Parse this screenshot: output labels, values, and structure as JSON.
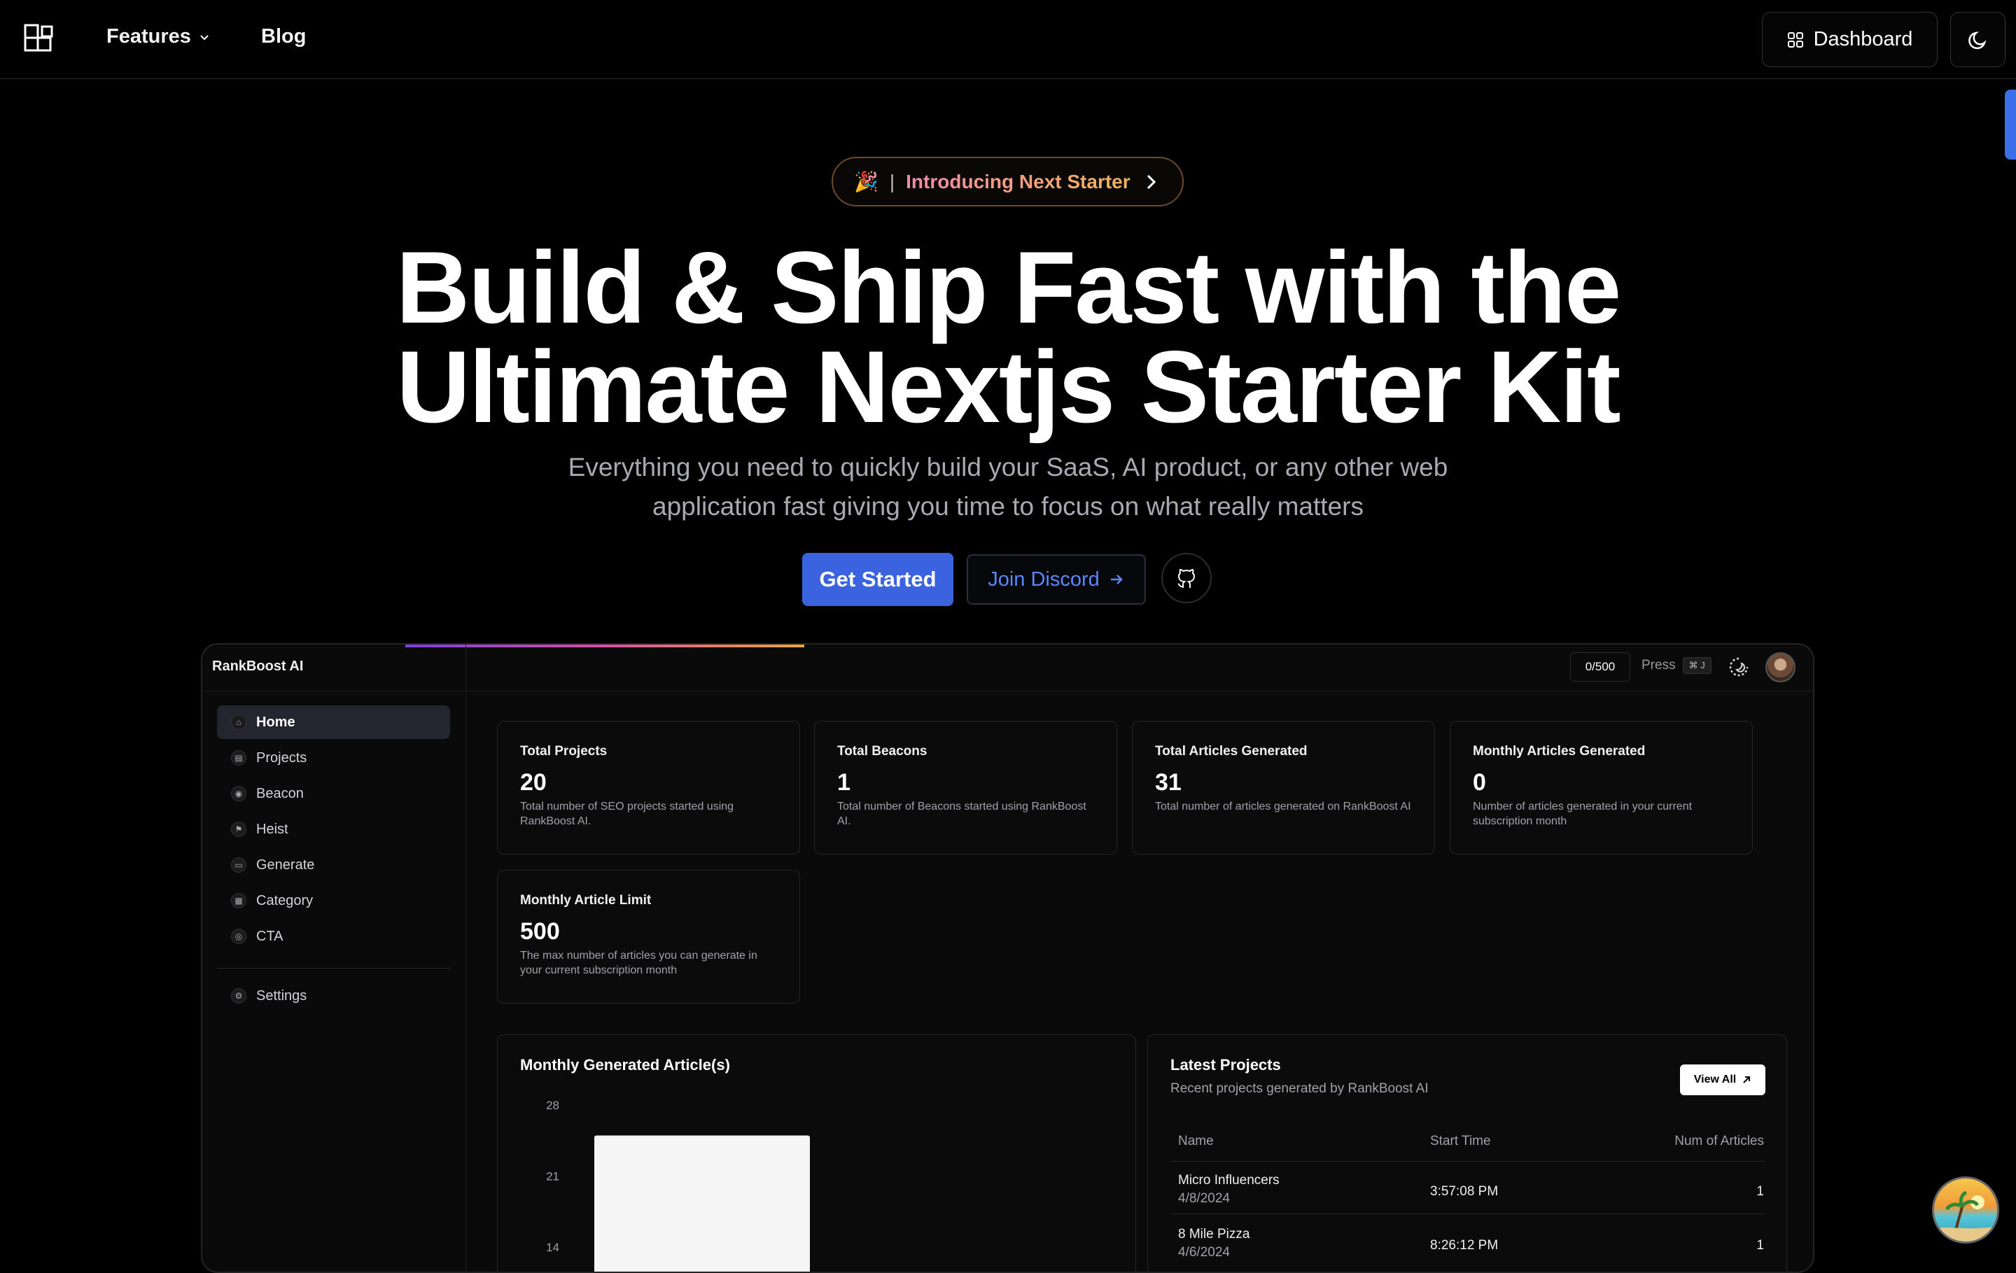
{
  "nav": {
    "features": "Features",
    "blog": "Blog",
    "dashboard": "Dashboard"
  },
  "hero": {
    "badge_emoji": "🎉",
    "badge_sep": "|",
    "badge_text": "Introducing Next Starter",
    "title_line1": "Build & Ship Fast with the",
    "title_line2": "Ultimate Nextjs Starter Kit",
    "subtitle_line1": "Everything you need to quickly build your SaaS, AI product, or any other web",
    "subtitle_line2": "application fast giving you time to focus on what really matters",
    "get_started": "Get Started",
    "join_discord": "Join Discord"
  },
  "app": {
    "brand": "RankBoost AI",
    "counter": "0/500",
    "press": "Press",
    "kbd": "⌘ J",
    "sidebar": [
      {
        "label": "Home",
        "icon": "home-icon",
        "glyph": "⌂"
      },
      {
        "label": "Projects",
        "icon": "file-icon",
        "glyph": "▤"
      },
      {
        "label": "Beacon",
        "icon": "beacon-icon",
        "glyph": "◉"
      },
      {
        "label": "Heist",
        "icon": "heist-icon",
        "glyph": "⚑"
      },
      {
        "label": "Generate",
        "icon": "folder-icon",
        "glyph": "▭"
      },
      {
        "label": "Category",
        "icon": "category-icon",
        "glyph": "▦"
      },
      {
        "label": "CTA",
        "icon": "target-icon",
        "glyph": "◎"
      }
    ],
    "settings": {
      "label": "Settings",
      "glyph": "⚙"
    },
    "cards": [
      {
        "title": "Total Projects",
        "value": "20",
        "desc": "Total number of SEO projects started using RankBoost AI."
      },
      {
        "title": "Total Beacons",
        "value": "1",
        "desc": "Total number of Beacons started using RankBoost AI."
      },
      {
        "title": "Total Articles Generated",
        "value": "31",
        "desc": "Total number of articles generated on RankBoost AI"
      },
      {
        "title": "Monthly Articles Generated",
        "value": "0",
        "desc": "Number of articles generated in your current subscription month"
      },
      {
        "title": "Monthly Article Limit",
        "value": "500",
        "desc": "The max number of articles you can generate in your current subscription month"
      }
    ],
    "chart_panel": {
      "title": "Monthly Generated Article(s)"
    },
    "projects": {
      "title": "Latest Projects",
      "subtitle": "Recent projects generated by RankBoost AI",
      "view_all": "View All",
      "headers": [
        "Name",
        "Start Time",
        "Num of Articles"
      ],
      "rows": [
        {
          "name": "Micro Influencers",
          "date": "4/8/2024",
          "time": "3:57:08 PM",
          "count": "1"
        },
        {
          "name": "8 Mile Pizza",
          "date": "4/6/2024",
          "time": "8:26:12 PM",
          "count": "1"
        }
      ]
    }
  },
  "chart_data": {
    "type": "bar",
    "title": "Monthly Generated Article(s)",
    "yticks": [
      "28",
      "21",
      "14"
    ],
    "ylim": [
      0,
      28
    ],
    "categories": [
      ""
    ],
    "values": [
      25
    ]
  }
}
